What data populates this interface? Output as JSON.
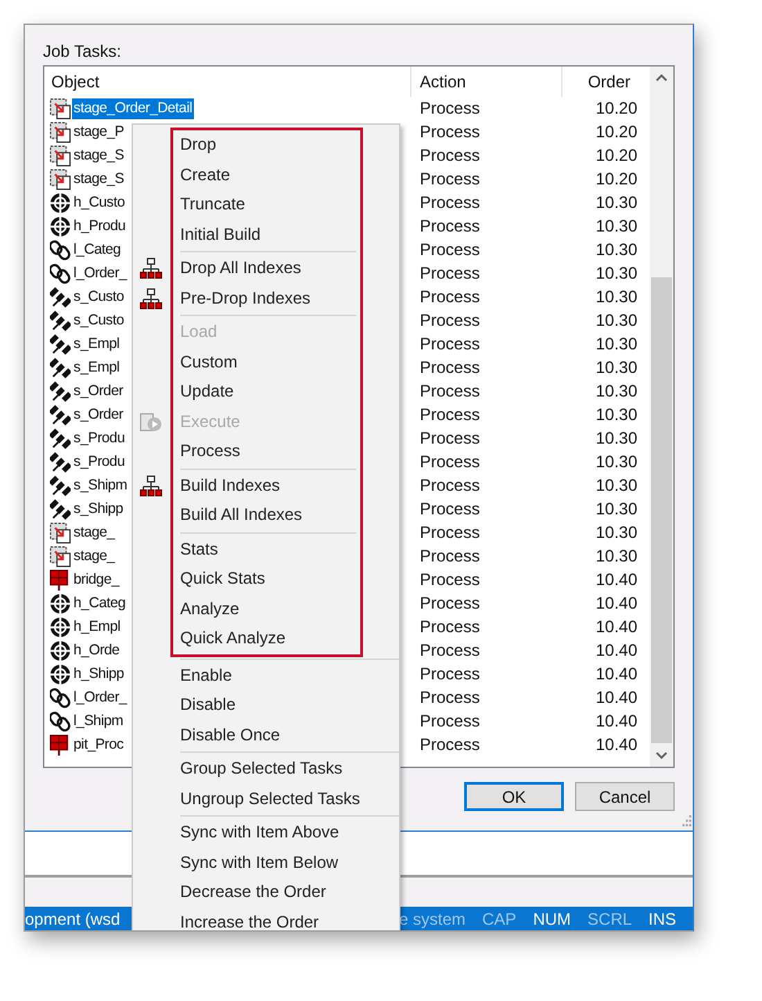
{
  "dialog": {
    "label": "Job Tasks:"
  },
  "table": {
    "columns": [
      "Object",
      "Action",
      "Order"
    ],
    "rows": [
      {
        "kind": "stage",
        "object": "stage_Order_Detail",
        "action": "Process",
        "order": "10.20",
        "selected": true
      },
      {
        "kind": "stage",
        "object": "stage_P",
        "action": "Process",
        "order": "10.20",
        "selected": false
      },
      {
        "kind": "stage",
        "object": "stage_S",
        "action": "Process",
        "order": "10.20",
        "selected": false
      },
      {
        "kind": "stage",
        "object": "stage_S",
        "action": "Process",
        "order": "10.20",
        "selected": false
      },
      {
        "kind": "hub",
        "object": "h_Custo",
        "action": "Process",
        "order": "10.30",
        "selected": false
      },
      {
        "kind": "hub",
        "object": "h_Produ",
        "action": "Process",
        "order": "10.30",
        "selected": false
      },
      {
        "kind": "link",
        "object": "l_Categ",
        "action": "Process",
        "order": "10.30",
        "selected": false
      },
      {
        "kind": "link",
        "object": "l_Order_",
        "action": "Process",
        "order": "10.30",
        "selected": false
      },
      {
        "kind": "satellite",
        "object": "s_Custo",
        "action": "Process",
        "order": "10.30",
        "selected": false
      },
      {
        "kind": "satellite",
        "object": "s_Custo",
        "action": "Process",
        "order": "10.30",
        "selected": false
      },
      {
        "kind": "satellite",
        "object": "s_Empl",
        "action": "Process",
        "order": "10.30",
        "selected": false
      },
      {
        "kind": "satellite",
        "object": "s_Empl",
        "action": "Process",
        "order": "10.30",
        "selected": false
      },
      {
        "kind": "satellite",
        "object": "s_Order",
        "action": "Process",
        "order": "10.30",
        "selected": false
      },
      {
        "kind": "satellite",
        "object": "s_Order",
        "action": "Process",
        "order": "10.30",
        "selected": false
      },
      {
        "kind": "satellite",
        "object": "s_Produ",
        "action": "Process",
        "order": "10.30",
        "selected": false
      },
      {
        "kind": "satellite",
        "object": "s_Produ",
        "action": "Process",
        "order": "10.30",
        "selected": false
      },
      {
        "kind": "satellite",
        "object": "s_Shipm",
        "action": "Process",
        "order": "10.30",
        "selected": false
      },
      {
        "kind": "satellite",
        "object": "s_Shipp",
        "action": "Process",
        "order": "10.30",
        "selected": false
      },
      {
        "kind": "stage",
        "object": "stage_",
        "action": "Process",
        "order": "10.30",
        "selected": false
      },
      {
        "kind": "stage",
        "object": "stage_",
        "action": "Process",
        "order": "10.30",
        "selected": false
      },
      {
        "kind": "bridge",
        "object": "bridge_",
        "action": "Process",
        "order": "10.40",
        "selected": false
      },
      {
        "kind": "hub",
        "object": "h_Categ",
        "action": "Process",
        "order": "10.40",
        "selected": false
      },
      {
        "kind": "hub",
        "object": "h_Empl",
        "action": "Process",
        "order": "10.40",
        "selected": false
      },
      {
        "kind": "hub",
        "object": "h_Orde",
        "action": "Process",
        "order": "10.40",
        "selected": false
      },
      {
        "kind": "hub",
        "object": "h_Shipp",
        "action": "Process",
        "order": "10.40",
        "selected": false
      },
      {
        "kind": "link",
        "object": "l_Order_",
        "action": "Process",
        "order": "10.40",
        "selected": false
      },
      {
        "kind": "link",
        "object": "l_Shipm",
        "action": "Process",
        "order": "10.40",
        "selected": false
      },
      {
        "kind": "bridge",
        "object": "pit_Proc",
        "action": "Process",
        "order": "10.40",
        "selected": false
      }
    ]
  },
  "context_menu": {
    "groups": [
      {
        "highlighted": true,
        "items": [
          {
            "label": "Drop",
            "disabled": false
          },
          {
            "label": "Create",
            "disabled": false
          },
          {
            "label": "Truncate",
            "disabled": false
          },
          {
            "label": "Initial Build",
            "disabled": false
          }
        ]
      },
      {
        "highlighted": true,
        "items": [
          {
            "label": "Drop All Indexes",
            "disabled": false,
            "kind": "index"
          },
          {
            "label": "Pre-Drop Indexes",
            "disabled": false,
            "kind": "index"
          }
        ]
      },
      {
        "highlighted": true,
        "items": [
          {
            "label": "Load",
            "disabled": true
          },
          {
            "label": "Custom",
            "disabled": false
          },
          {
            "label": "Update",
            "disabled": false
          },
          {
            "label": "Execute",
            "disabled": true,
            "kind": "execute"
          },
          {
            "label": "Process",
            "disabled": false
          }
        ]
      },
      {
        "highlighted": true,
        "items": [
          {
            "label": "Build Indexes",
            "disabled": false,
            "kind": "index"
          },
          {
            "label": "Build All Indexes",
            "disabled": false
          }
        ]
      },
      {
        "highlighted": true,
        "items": [
          {
            "label": "Stats",
            "disabled": false
          },
          {
            "label": "Quick Stats",
            "disabled": false
          },
          {
            "label": "Analyze",
            "disabled": false
          },
          {
            "label": "Quick Analyze",
            "disabled": false
          }
        ]
      },
      {
        "highlighted": false,
        "items": [
          {
            "label": "Enable",
            "disabled": false
          },
          {
            "label": "Disable",
            "disabled": false
          },
          {
            "label": "Disable Once",
            "disabled": false
          }
        ]
      },
      {
        "highlighted": false,
        "items": [
          {
            "label": "Group Selected Tasks",
            "disabled": false
          },
          {
            "label": "Ungroup Selected Tasks",
            "disabled": false
          }
        ]
      },
      {
        "highlighted": false,
        "items": [
          {
            "label": "Sync with Item Above",
            "disabled": false
          },
          {
            "label": "Sync with Item Below",
            "disabled": false
          },
          {
            "label": "Decrease the Order",
            "disabled": false
          },
          {
            "label": "Increase the Order",
            "disabled": false
          }
        ]
      }
    ]
  },
  "buttons": [
    {
      "label": "OK",
      "default": true
    },
    {
      "label": "Cancel",
      "default": false
    }
  ],
  "status_bar": {
    "left": "opment (wsd",
    "middle": "e system",
    "indicators": [
      {
        "label": "CAP",
        "on": false
      },
      {
        "label": "NUM",
        "on": true
      },
      {
        "label": "SCRL",
        "on": false
      },
      {
        "label": "INS",
        "on": true
      }
    ]
  }
}
